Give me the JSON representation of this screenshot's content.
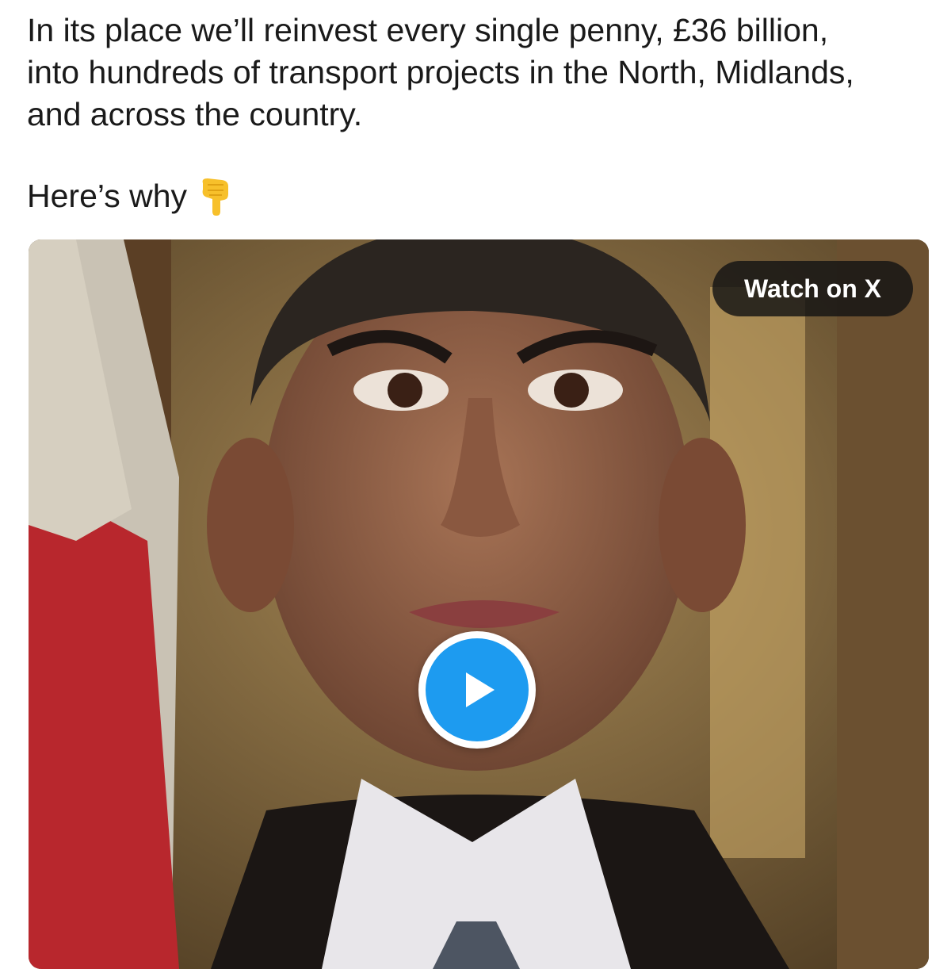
{
  "tweet": {
    "lines": [
      "In its place we’ll reinvest every single penny, £36 billion,",
      "into hundreds of transport projects in the North, Midlands,",
      "and across the country."
    ],
    "why_text": "Here’s why",
    "emoji_icon": "backhand-index-pointing-down-icon"
  },
  "media": {
    "watch_label": "Watch on X",
    "play_icon": "play-icon",
    "accent_color": "#1d9bf0"
  }
}
